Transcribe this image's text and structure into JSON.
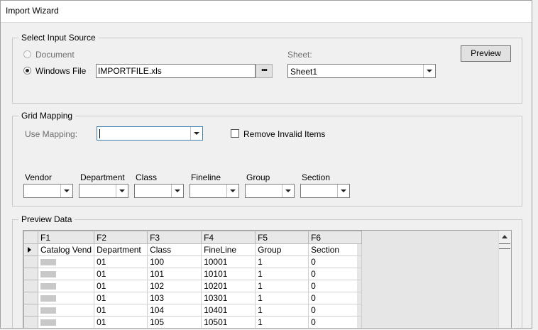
{
  "window": {
    "title": "Import Wizard"
  },
  "input_source": {
    "title": "Select Input Source",
    "document_label": "Document",
    "windows_file_label": "Windows File",
    "file_value": "IMPORTFILE.xls",
    "browse_label": "•••",
    "sheet_label": "Sheet:",
    "sheet_value": "Sheet1",
    "preview_button": "Preview"
  },
  "grid_mapping": {
    "title": "Grid Mapping",
    "use_mapping_label": "Use Mapping:",
    "use_mapping_value": "",
    "remove_invalid_label": "Remove Invalid Items",
    "fields": [
      {
        "label": "Vendor",
        "value": ""
      },
      {
        "label": "Department",
        "value": ""
      },
      {
        "label": "Class",
        "value": ""
      },
      {
        "label": "Fineline",
        "value": ""
      },
      {
        "label": "Group",
        "value": ""
      },
      {
        "label": "Section",
        "value": ""
      }
    ]
  },
  "preview_data": {
    "title": "Preview Data",
    "columns": [
      "F1",
      "F2",
      "F3",
      "F4",
      "F5",
      "F6"
    ],
    "header_row": [
      "Catalog Vend",
      "Department",
      "Class",
      "FineLine",
      "Group",
      "Section"
    ],
    "rows": [
      [
        "",
        "01",
        "100",
        "10001",
        "1",
        "0"
      ],
      [
        "",
        "01",
        "101",
        "10101",
        "1",
        "0"
      ],
      [
        "",
        "01",
        "102",
        "10201",
        "1",
        "0"
      ],
      [
        "",
        "01",
        "103",
        "10301",
        "1",
        "0"
      ],
      [
        "",
        "01",
        "104",
        "10401",
        "1",
        "0"
      ],
      [
        "",
        "01",
        "105",
        "10501",
        "1",
        "0"
      ]
    ]
  }
}
